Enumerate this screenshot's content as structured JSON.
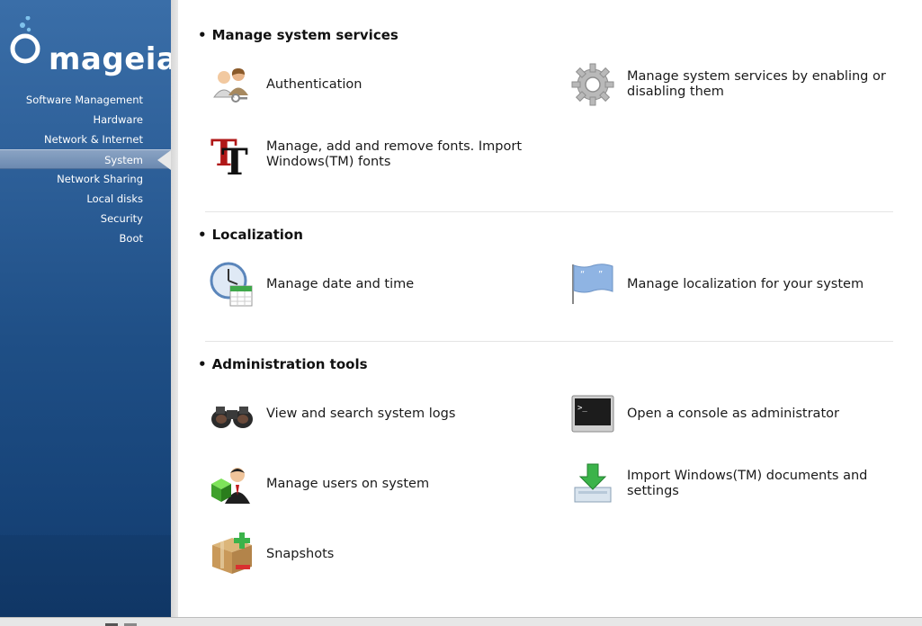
{
  "brand": {
    "name": "mageia"
  },
  "sidebar": {
    "items": [
      {
        "label": "Software Management"
      },
      {
        "label": "Hardware"
      },
      {
        "label": "Network & Internet"
      },
      {
        "label": "System",
        "active": true
      },
      {
        "label": "Network Sharing"
      },
      {
        "label": "Local disks"
      },
      {
        "label": "Security"
      },
      {
        "label": "Boot"
      }
    ]
  },
  "sections": [
    {
      "title": "Manage system services",
      "items": [
        {
          "label": "Authentication",
          "icon": "authentication-users-icon"
        },
        {
          "label": "Manage system services by enabling or disabling them",
          "icon": "gear-icon"
        },
        {
          "label": "Manage, add and remove fonts. Import Windows(TM) fonts",
          "icon": "font-tt-icon"
        }
      ]
    },
    {
      "title": "Localization",
      "items": [
        {
          "label": "Manage date and time",
          "icon": "clock-calendar-icon"
        },
        {
          "label": "Manage localization for your system",
          "icon": "flag-icon"
        }
      ]
    },
    {
      "title": "Administration tools",
      "items": [
        {
          "label": "View and search system logs",
          "icon": "binoculars-icon"
        },
        {
          "label": "Open a console as administrator",
          "icon": "terminal-icon"
        },
        {
          "label": "Manage users on system",
          "icon": "user-cube-icon"
        },
        {
          "label": "Import Windows(TM) documents and settings",
          "icon": "download-tray-icon"
        },
        {
          "label": "Snapshots",
          "icon": "package-box-icon"
        }
      ]
    }
  ],
  "colors": {
    "sidebar_top": "#3a6ea8",
    "sidebar_bottom": "#123a6c",
    "active_item": "#7b96ba",
    "text": "#1a1a1a"
  }
}
